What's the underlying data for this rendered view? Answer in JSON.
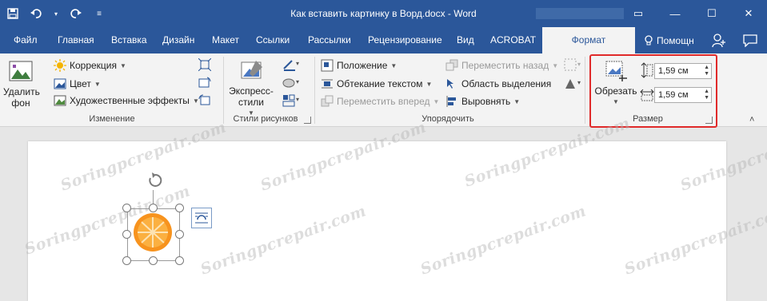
{
  "titlebar": {
    "title": "Как вставить картинку в Ворд.docx - Word",
    "controls": [
      "▭",
      "—",
      "☐",
      "✕"
    ]
  },
  "tabs": [
    {
      "label": "Файл"
    },
    {
      "label": "Главная"
    },
    {
      "label": "Вставка"
    },
    {
      "label": "Дизайн"
    },
    {
      "label": "Макет"
    },
    {
      "label": "Ссылки"
    },
    {
      "label": "Рассылки"
    },
    {
      "label": "Рецензирование"
    },
    {
      "label": "Вид"
    },
    {
      "label": "ACROBAT"
    },
    {
      "label": "Формат",
      "active": true
    }
  ],
  "help": {
    "label": "Помощн"
  },
  "ribbon": {
    "remove_bg": {
      "line1": "Удалить",
      "line2": "фон"
    },
    "adjust": {
      "correction": "Коррекция",
      "color": "Цвет",
      "artistic": "Художественные эффекты",
      "group": "Изменение"
    },
    "styles": {
      "express_line1": "Экспресс-",
      "express_line2": "стили",
      "group": "Стили рисунков"
    },
    "arrange": {
      "position": "Положение",
      "wrap": "Обтекание текстом",
      "forward": "Переместить вперед",
      "backward": "Переместить назад",
      "selection_pane": "Область выделения",
      "align": "Выровнять",
      "group": "Упорядочить"
    },
    "size": {
      "crop": "Обрезать",
      "height": "1,59 см",
      "width": "1,59 см",
      "group": "Размер"
    }
  },
  "watermark": "Soringpcrepair.com",
  "colors": {
    "title_bar": "#2b579a",
    "ribbon": "#f3f3f3",
    "highlight": "#e02a2a",
    "orange": "#f7931e"
  }
}
